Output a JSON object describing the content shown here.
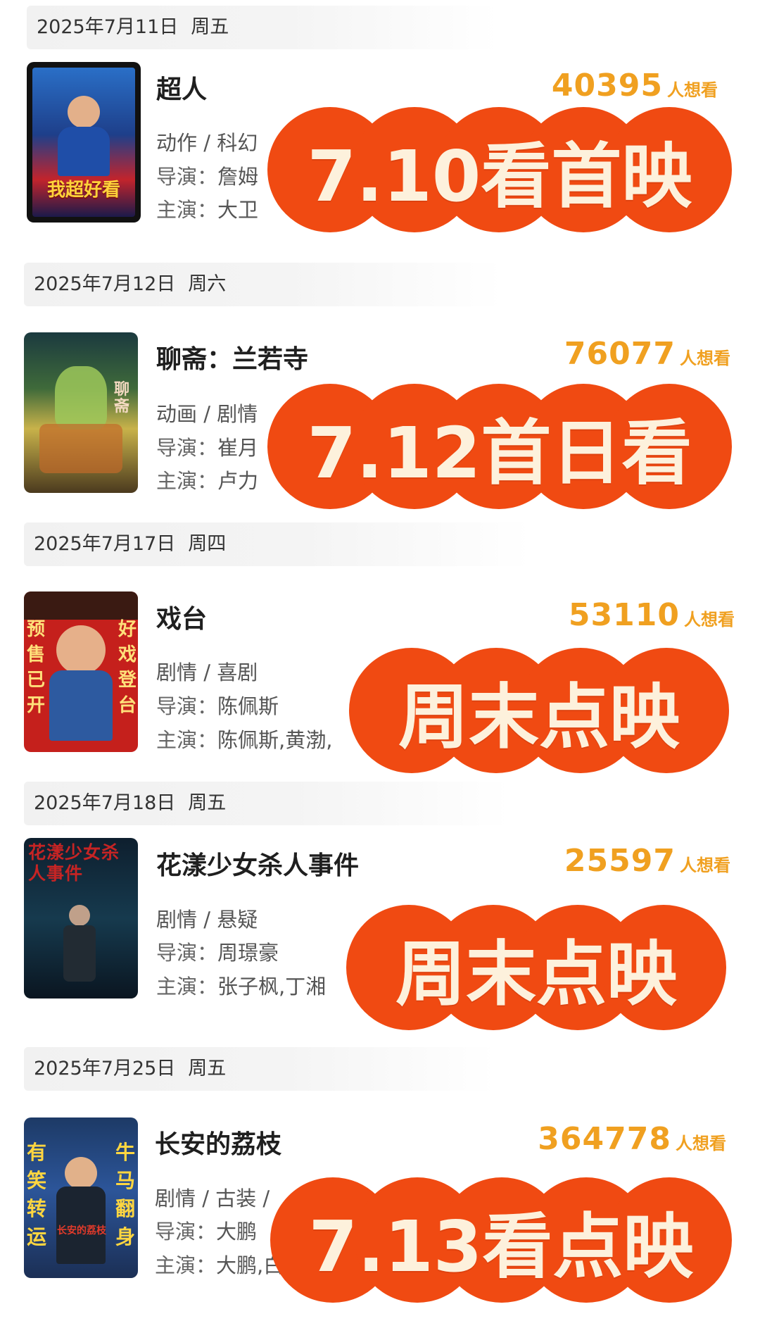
{
  "want_suffix": "人想看",
  "colors": {
    "accent_orange": "#f0a020",
    "stamp_red": "#f04a12",
    "stamp_text": "#fdf1dc"
  },
  "movies": [
    {
      "date": "2025年7月11日",
      "weekday": "周五",
      "title": "超人",
      "want_count": "40395",
      "genre": "动作 / 科幻",
      "director_label": "导演：",
      "director": "詹姆",
      "cast_label": "主演：",
      "cast": "大卫",
      "poster_text": "我超好看",
      "stamp": "7.10看首映"
    },
    {
      "date": "2025年7月12日",
      "weekday": "周六",
      "title": "聊斋：兰若寺",
      "want_count": "76077",
      "genre": "动画 / 剧情",
      "director_label": "导演：",
      "director": "崔月",
      "cast_label": "主演：",
      "cast": "卢力",
      "poster_text": "聊斋",
      "stamp": "7.12首日看"
    },
    {
      "date": "2025年7月17日",
      "weekday": "周四",
      "title": "戏台",
      "want_count": "53110",
      "genre": "剧情 / 喜剧",
      "director_label": "导演：",
      "director": "陈佩斯",
      "cast_label": "主演：",
      "cast": "陈佩斯,黄渤,",
      "poster_left": "预售已开",
      "poster_right": "好戏登台",
      "stamp": "周末点映"
    },
    {
      "date": "2025年7月18日",
      "weekday": "周五",
      "title": "花漾少女杀人事件",
      "want_count": "25597",
      "genre": "剧情 / 悬疑",
      "director_label": "导演：",
      "director": "周璟豪",
      "cast_label": "主演：",
      "cast": "张子枫,丁湘",
      "poster_text": "花漾少女杀人事件",
      "stamp": "周末点映"
    },
    {
      "date": "2025年7月25日",
      "weekday": "周五",
      "title": "长安的荔枝",
      "want_count": "364778",
      "genre": "剧情 / 古装 / ",
      "director_label": "导演：",
      "director": "大鹏",
      "cast_label": "主演：",
      "cast": "大鹏,白",
      "poster_left": "有笑转运",
      "poster_right": "牛马翻身",
      "poster_center": "长安的荔枝",
      "stamp": "7.13看点映"
    }
  ]
}
